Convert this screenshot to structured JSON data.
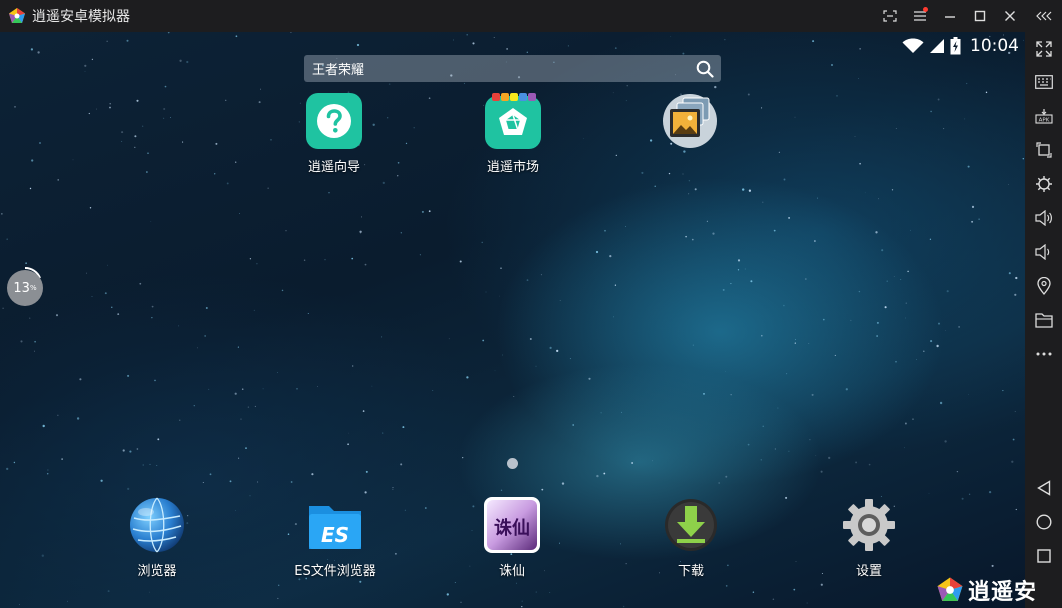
{
  "window": {
    "title": "逍遥安卓模拟器",
    "controls": [
      "screen-capture-icon",
      "menu-icon",
      "minimize-icon",
      "maximize-icon",
      "close-icon",
      "collapse-sidebar-icon"
    ]
  },
  "statusbar": {
    "time": "10:04"
  },
  "search": {
    "text": "王者荣耀"
  },
  "apps": {
    "guide": {
      "label": "逍遥向导"
    },
    "market": {
      "label": "逍遥市场"
    },
    "gallery": {
      "label": ""
    },
    "browser": {
      "label": "浏览器"
    },
    "es": {
      "label": "ES文件浏览器",
      "glyph": "ES"
    },
    "zhuxian": {
      "label": "诛仙",
      "glyph": "诛仙"
    },
    "download": {
      "label": "下载"
    },
    "settings": {
      "label": "设置"
    }
  },
  "progress": {
    "value": "13",
    "unit": "%"
  },
  "sidebar": {
    "icons": [
      "fullscreen-icon",
      "keyboard-icon",
      "apk-install-icon",
      "rotate-icon",
      "shake-icon",
      "volume-up-icon",
      "volume-down-icon",
      "location-icon",
      "folder-icon",
      "more-icon",
      "back-icon",
      "home-icon",
      "recents-icon"
    ]
  },
  "watermark": {
    "text": "逍遥安"
  },
  "colors": {
    "titlebar": "#1d1d1f",
    "guide": "#1fc3a1",
    "market": "#1fc3a1",
    "red_dot": "#ff3b30"
  }
}
